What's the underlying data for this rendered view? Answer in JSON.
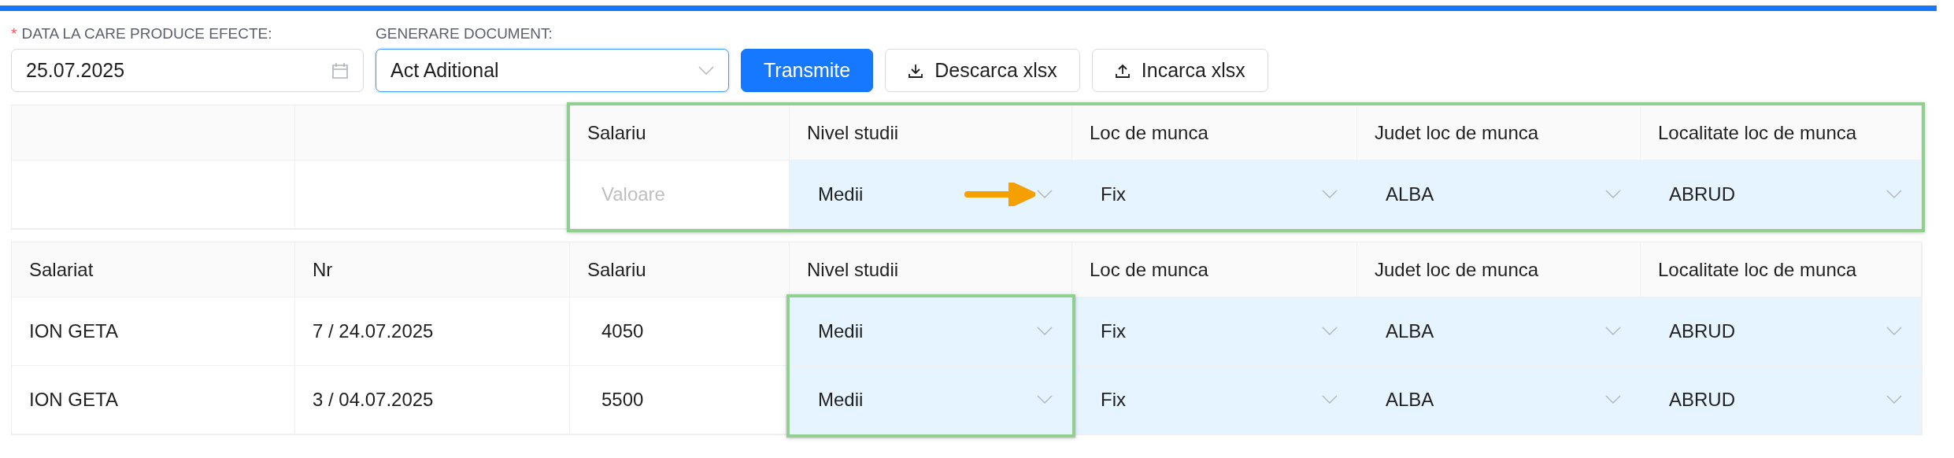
{
  "form": {
    "date_field": {
      "label": "DATA LA CARE PRODUCE EFECTE:",
      "required_mark": "*",
      "value": "25.07.2025"
    },
    "document_field": {
      "label": "GENERARE DOCUMENT:",
      "value": "Act Aditional",
      "focused": true
    },
    "buttons": [
      {
        "label": "Transmite",
        "kind": "primary"
      },
      {
        "label": "Descarca xlsx",
        "kind": "download"
      },
      {
        "label": "Incarca xlsx",
        "kind": "upload"
      }
    ]
  },
  "bulk_edit_table": {
    "frame_includes_header": true,
    "columns": [
      {
        "kind": "blank",
        "highlighted": false
      },
      {
        "kind": "blank",
        "highlighted": false
      },
      {
        "kind": "label",
        "label": "Salariu",
        "highlighted": true
      },
      {
        "kind": "label",
        "label": "Nivel studii",
        "highlighted": true
      },
      {
        "kind": "label",
        "label": "Loc de munca",
        "highlighted": true
      },
      {
        "kind": "label",
        "label": "Judet loc de munca",
        "highlighted": true
      },
      {
        "kind": "label",
        "label": "Localitate loc de munca",
        "highlighted": true
      }
    ],
    "row": [
      {
        "kind": "blank"
      },
      {
        "kind": "blank"
      },
      {
        "kind": "input",
        "placeholder": "Valoare"
      },
      {
        "kind": "select",
        "value": "Medii",
        "pointer_arrow": true
      },
      {
        "kind": "select",
        "value": "Fix",
        "pointer_arrow": false
      },
      {
        "kind": "select",
        "value": "ALBA",
        "pointer_arrow": false
      },
      {
        "kind": "select",
        "value": "ABRUD",
        "pointer_arrow": false
      }
    ]
  },
  "employees_table": {
    "frame_includes_header": false,
    "columns": [
      {
        "kind": "label",
        "label": "Salariat",
        "highlighted": false
      },
      {
        "kind": "label",
        "label": "Nr",
        "highlighted": false
      },
      {
        "kind": "label",
        "label": "Salariu",
        "highlighted": false
      },
      {
        "kind": "label",
        "label": "Nivel studii",
        "highlighted": true
      },
      {
        "kind": "label",
        "label": "Loc de munca",
        "highlighted": false
      },
      {
        "kind": "label",
        "label": "Judet loc de munca",
        "highlighted": false
      },
      {
        "kind": "label",
        "label": "Localitate loc de munca",
        "highlighted": false
      }
    ],
    "rows": [
      [
        {
          "kind": "text",
          "value": "ION GETA"
        },
        {
          "kind": "text",
          "value": "7 / 24.07.2025"
        },
        {
          "kind": "number",
          "value": "4050"
        },
        {
          "kind": "select",
          "value": "Medii"
        },
        {
          "kind": "select",
          "value": "Fix"
        },
        {
          "kind": "select",
          "value": "ALBA"
        },
        {
          "kind": "select",
          "value": "ABRUD"
        }
      ],
      [
        {
          "kind": "text",
          "value": "ION GETA"
        },
        {
          "kind": "text",
          "value": "3 / 04.07.2025"
        },
        {
          "kind": "number",
          "value": "5500"
        },
        {
          "kind": "select",
          "value": "Medii"
        },
        {
          "kind": "select",
          "value": "Fix"
        },
        {
          "kind": "select",
          "value": "ALBA"
        },
        {
          "kind": "select",
          "value": "ABRUD"
        }
      ]
    ]
  }
}
